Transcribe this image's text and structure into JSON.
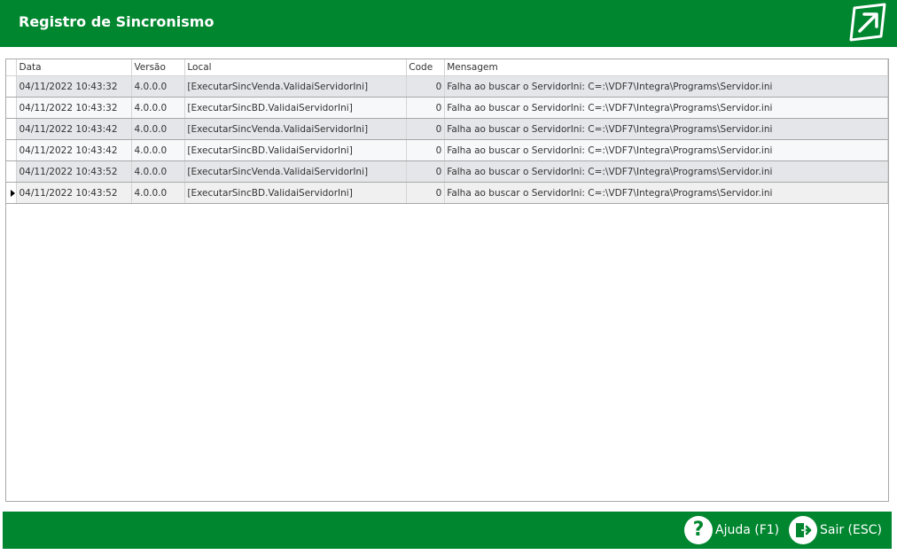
{
  "window": {
    "title": "Registro de Sincronismo"
  },
  "colors": {
    "brand_green": "#00862f"
  },
  "grid": {
    "columns": [
      "Data",
      "Versão",
      "Local",
      "Code",
      "Mensagem"
    ],
    "rows": [
      {
        "data": "04/11/2022 10:43:32",
        "versao": "4.0.0.0",
        "local": "[ExecutarSincVenda.ValidaiServidorIni]",
        "code": "0",
        "mensagem": "Falha ao buscar o ServidorIni: C=:\\VDF7\\Integra\\Programs\\Servidor.ini"
      },
      {
        "data": "04/11/2022 10:43:32",
        "versao": "4.0.0.0",
        "local": "[ExecutarSincBD.ValidaiServidorIni]",
        "code": "0",
        "mensagem": "Falha ao buscar o ServidorIni: C=:\\VDF7\\Integra\\Programs\\Servidor.ini"
      },
      {
        "data": "04/11/2022 10:43:42",
        "versao": "4.0.0.0",
        "local": "[ExecutarSincVenda.ValidaiServidorIni]",
        "code": "0",
        "mensagem": "Falha ao buscar o ServidorIni: C=:\\VDF7\\Integra\\Programs\\Servidor.ini"
      },
      {
        "data": "04/11/2022 10:43:42",
        "versao": "4.0.0.0",
        "local": "[ExecutarSincBD.ValidaiServidorIni]",
        "code": "0",
        "mensagem": "Falha ao buscar o ServidorIni: C=:\\VDF7\\Integra\\Programs\\Servidor.ini"
      },
      {
        "data": "04/11/2022 10:43:52",
        "versao": "4.0.0.0",
        "local": "[ExecutarSincVenda.ValidaiServidorIni]",
        "code": "0",
        "mensagem": "Falha ao buscar o ServidorIni: C=:\\VDF7\\Integra\\Programs\\Servidor.ini"
      },
      {
        "data": "04/11/2022 10:43:52",
        "versao": "4.0.0.0",
        "local": "[ExecutarSincBD.ValidaiServidorIni]",
        "code": "0",
        "mensagem": "Falha ao buscar o ServidorIni: C=:\\VDF7\\Integra\\Programs\\Servidor.ini"
      }
    ]
  },
  "footer": {
    "help_label": "Ajuda (F1)",
    "help_icon": "question-icon",
    "exit_label": "Sair (ESC)",
    "exit_icon": "exit-door-icon"
  }
}
